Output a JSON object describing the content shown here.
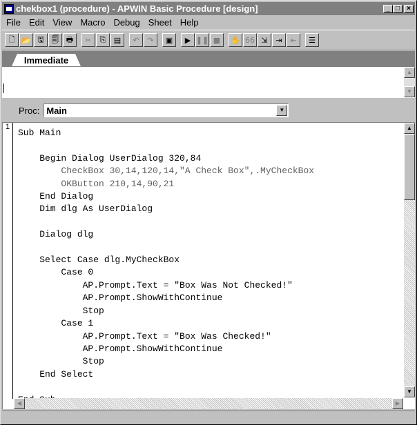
{
  "window": {
    "title": "chekbox1 (procedure) - APWIN Basic Procedure [design]",
    "controls": {
      "minimize": "_",
      "maximize": "□",
      "close": "×"
    }
  },
  "menu": [
    {
      "label": "File"
    },
    {
      "label": "Edit"
    },
    {
      "label": "View"
    },
    {
      "label": "Macro"
    },
    {
      "label": "Debug"
    },
    {
      "label": "Sheet"
    },
    {
      "label": "Help"
    }
  ],
  "toolbar": {
    "buttons": [
      {
        "icon": "new-icon",
        "glyph": "🗋"
      },
      {
        "icon": "open-icon",
        "glyph": "📂"
      },
      {
        "icon": "save-icon",
        "glyph": "🖫"
      },
      {
        "icon": "save-all-icon",
        "glyph": "🗐"
      },
      {
        "icon": "print-icon",
        "glyph": "🖶"
      },
      {
        "icon": "cut-icon",
        "glyph": "✂"
      },
      {
        "icon": "copy-icon",
        "glyph": "⎘"
      },
      {
        "icon": "paste-icon",
        "glyph": "▤"
      },
      {
        "icon": "undo-icon",
        "glyph": "↶"
      },
      {
        "icon": "redo-icon",
        "glyph": "↷"
      },
      {
        "icon": "dialog-editor-icon",
        "glyph": "▣"
      },
      {
        "icon": "run-icon",
        "glyph": "▶"
      },
      {
        "icon": "pause-icon",
        "glyph": "❚❚"
      },
      {
        "icon": "stop-icon",
        "glyph": "■"
      },
      {
        "icon": "breakpoint-icon",
        "glyph": "✋"
      },
      {
        "icon": "quick-watch-icon",
        "glyph": "66"
      },
      {
        "icon": "step-into-icon",
        "glyph": "⇲"
      },
      {
        "icon": "step-over-icon",
        "glyph": "⇥"
      },
      {
        "icon": "step-out-icon",
        "glyph": "⇤"
      },
      {
        "icon": "calls-icon",
        "glyph": "☰"
      }
    ]
  },
  "tabs": [
    {
      "label": "Immediate"
    }
  ],
  "proc": {
    "label": "Proc:",
    "value": "Main"
  },
  "editor": {
    "gutter": "1",
    "lines": [
      "Sub Main",
      "",
      "    Begin Dialog UserDialog 320,84",
      "        CheckBox 30,14,120,14,\"A Check Box\",.MyCheckBox",
      "        OKButton 210,14,90,21",
      "    End Dialog",
      "    Dim dlg As UserDialog",
      "",
      "    Dialog dlg",
      "",
      "    Select Case dlg.MyCheckBox",
      "        Case 0",
      "            AP.Prompt.Text = \"Box Was Not Checked!\"",
      "            AP.Prompt.ShowWithContinue",
      "            Stop",
      "        Case 1",
      "            AP.Prompt.Text = \"Box Was Checked!\"",
      "            AP.Prompt.ShowWithContinue",
      "            Stop",
      "    End Select",
      "",
      "End Sub"
    ]
  }
}
